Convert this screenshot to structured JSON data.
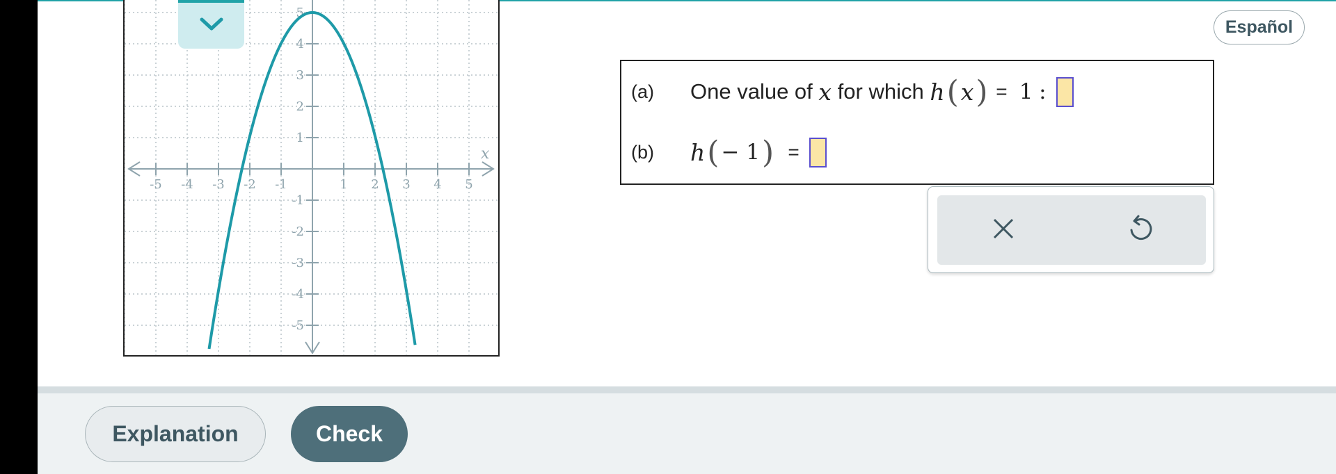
{
  "language_button": "Español",
  "graph": {
    "axis_label_x": "x",
    "x_ticks": [
      "-5",
      "-4",
      "-3",
      "-2",
      "-1",
      "1",
      "2",
      "3",
      "4",
      "5"
    ],
    "y_ticks": [
      "5",
      "4",
      "3",
      "2",
      "1",
      "-1",
      "-2",
      "-3",
      "-4",
      "-5"
    ],
    "curve": {
      "vertex": [
        0,
        5
      ],
      "x_intercepts": [
        -2.25,
        2.25
      ]
    },
    "colors": {
      "curve": "#1e9aa8",
      "axes": "#8fa4ad",
      "grid": "#b9c4c8"
    },
    "collapse_icon": "chevron-down-icon"
  },
  "question": {
    "a": {
      "letter": "(a)",
      "text": "One value of",
      "var": "x",
      "text2": "for which",
      "func": "h",
      "arg": "x",
      "equals": "=",
      "rhs": "1",
      "colon": ":"
    },
    "b": {
      "letter": "(b)",
      "func": "h",
      "arg": "− 1",
      "equals": "="
    }
  },
  "keypad": {
    "clear_icon": "close-icon",
    "undo_icon": "undo-icon"
  },
  "footer": {
    "explanation_label": "Explanation",
    "check_label": "Check"
  }
}
